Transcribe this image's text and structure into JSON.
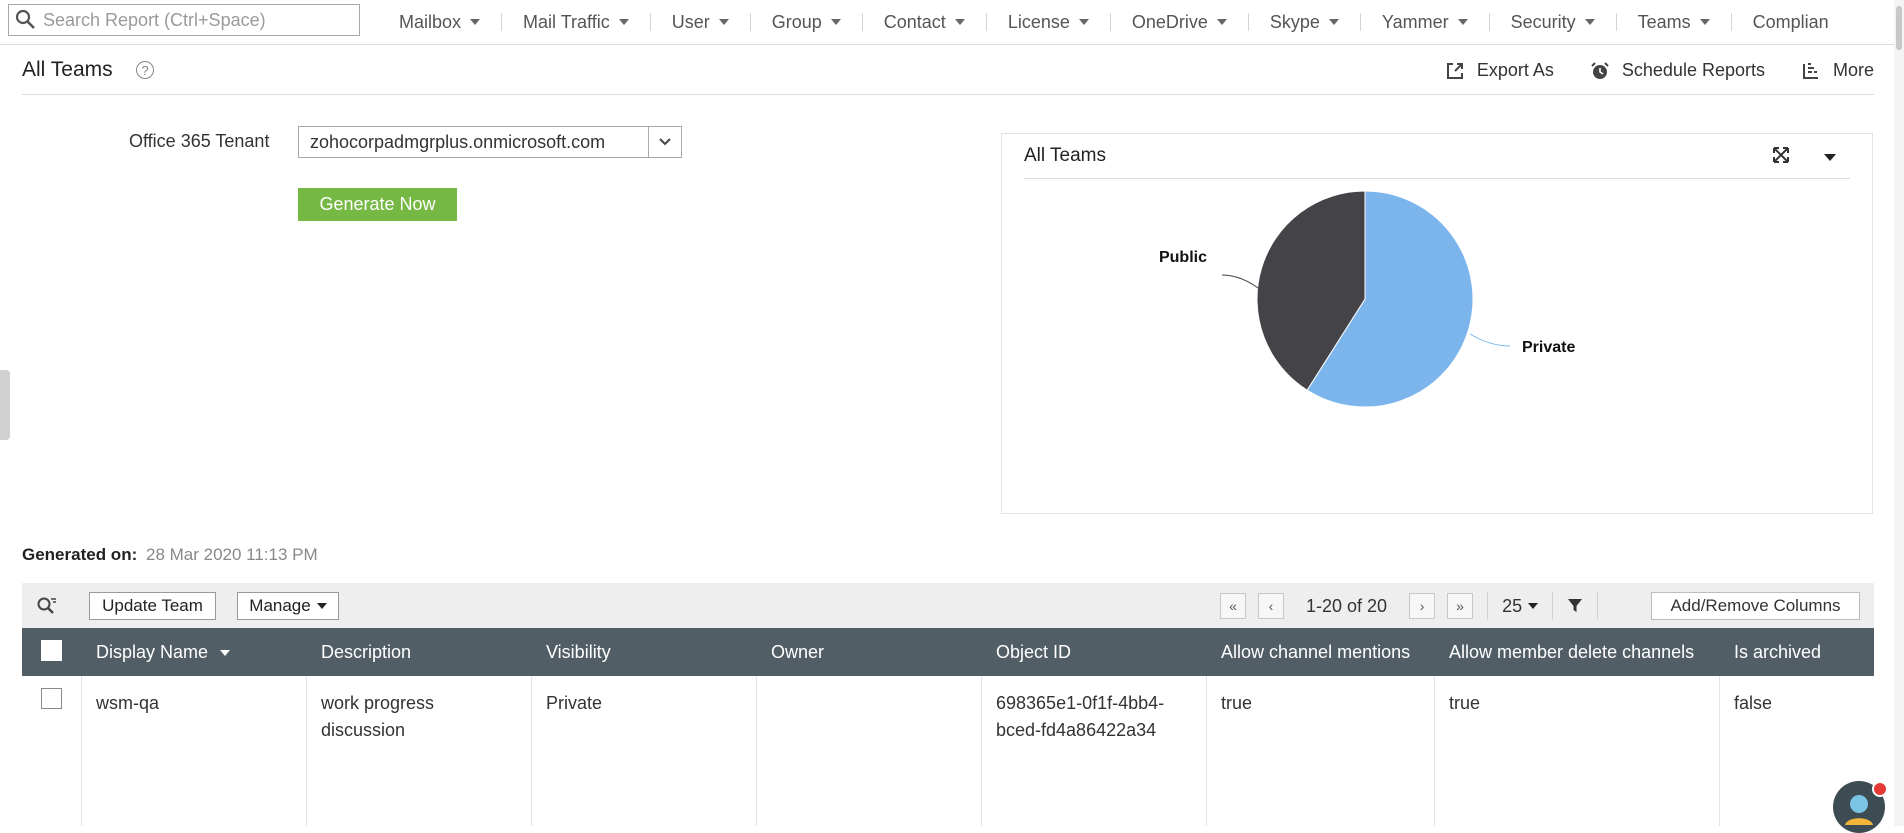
{
  "search": {
    "placeholder": "Search Report (Ctrl+Space)"
  },
  "nav": {
    "items": [
      {
        "label": "Mailbox"
      },
      {
        "label": "Mail Traffic"
      },
      {
        "label": "User"
      },
      {
        "label": "Group"
      },
      {
        "label": "Contact"
      },
      {
        "label": "License"
      },
      {
        "label": "OneDrive"
      },
      {
        "label": "Skype"
      },
      {
        "label": "Yammer"
      },
      {
        "label": "Security"
      },
      {
        "label": "Teams"
      },
      {
        "label": "Complian"
      }
    ]
  },
  "header": {
    "title": "All Teams",
    "help_icon": "?",
    "actions": [
      {
        "label": "Export As",
        "icon": "export-icon"
      },
      {
        "label": "Schedule Reports",
        "icon": "alarm-clock-icon"
      },
      {
        "label": "More",
        "icon": "more-icon"
      }
    ]
  },
  "form": {
    "tenant_label": "Office 365 Tenant",
    "tenant_value": "zohocorpadmgrplus.onmicrosoft.com",
    "generate_label": "Generate Now"
  },
  "chart_data": {
    "type": "pie",
    "title": "All Teams",
    "categories": [
      "Private",
      "Public"
    ],
    "values": [
      59,
      41
    ],
    "colors": [
      "#7cb5ec",
      "#434348"
    ]
  },
  "generated": {
    "label": "Generated on:",
    "value": "28 Mar 2020 11:13 PM"
  },
  "toolbar": {
    "update_team": "Update Team",
    "manage": "Manage",
    "page_range": "1-20 of 20",
    "page_size": "25",
    "add_remove_columns": "Add/Remove Columns"
  },
  "table": {
    "columns": [
      "Display Name",
      "Description",
      "Visibility",
      "Owner",
      "Object ID",
      "Allow channel mentions",
      "Allow member delete channels",
      "Is archived"
    ],
    "rows": [
      {
        "display_name": "wsm-qa",
        "description_l1": "work progress",
        "description_l2": "discussion",
        "visibility": "Private",
        "owner": "",
        "object_id_l1": "698365e1-0f1f-4bb4-",
        "object_id_l2": "bced-fd4a86422a34",
        "allow_channel_mentions": "true",
        "allow_member_delete_channels": "true",
        "is_archived": "false"
      }
    ]
  },
  "colors": {
    "header_bg": "#525e66",
    "accent_green": "#76b844",
    "private_slice": "#7cb5ec",
    "public_slice": "#434348"
  }
}
